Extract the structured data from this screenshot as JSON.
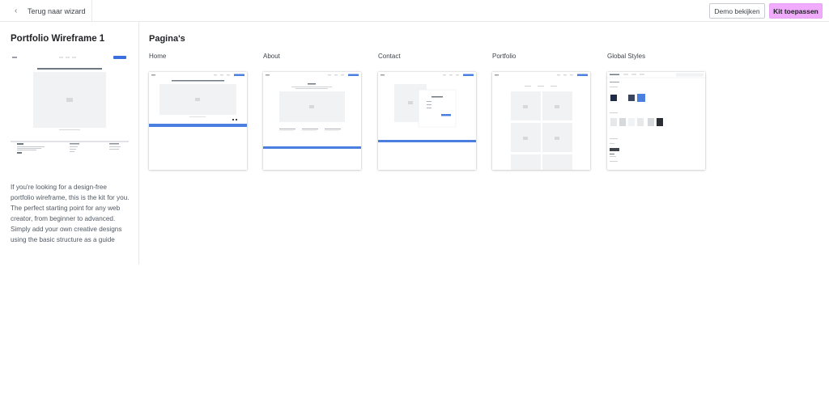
{
  "topbar": {
    "back_label": "Terug naar wizard",
    "demo_label": "Demo bekijken",
    "apply_label": "Kit toepassen"
  },
  "sidebar": {
    "kit_title": "Portfolio Wireframe 1",
    "description": "If you're looking for a design-free portfolio wireframe, this is the kit for you. The perfect starting point for any web creator, from beginner to advanced. Simply add your own creative designs using the basic structure as a guide"
  },
  "main": {
    "section_title": "Pagina's",
    "pages": [
      {
        "label": "Home"
      },
      {
        "label": "About"
      },
      {
        "label": "Contact"
      },
      {
        "label": "Portfolio"
      },
      {
        "label": "Global Styles"
      }
    ]
  },
  "colors": {
    "accent_button": "#f0abfc",
    "wireframe_blue": "#4a7fe0",
    "wireframe_gray": "#f1f2f4"
  }
}
